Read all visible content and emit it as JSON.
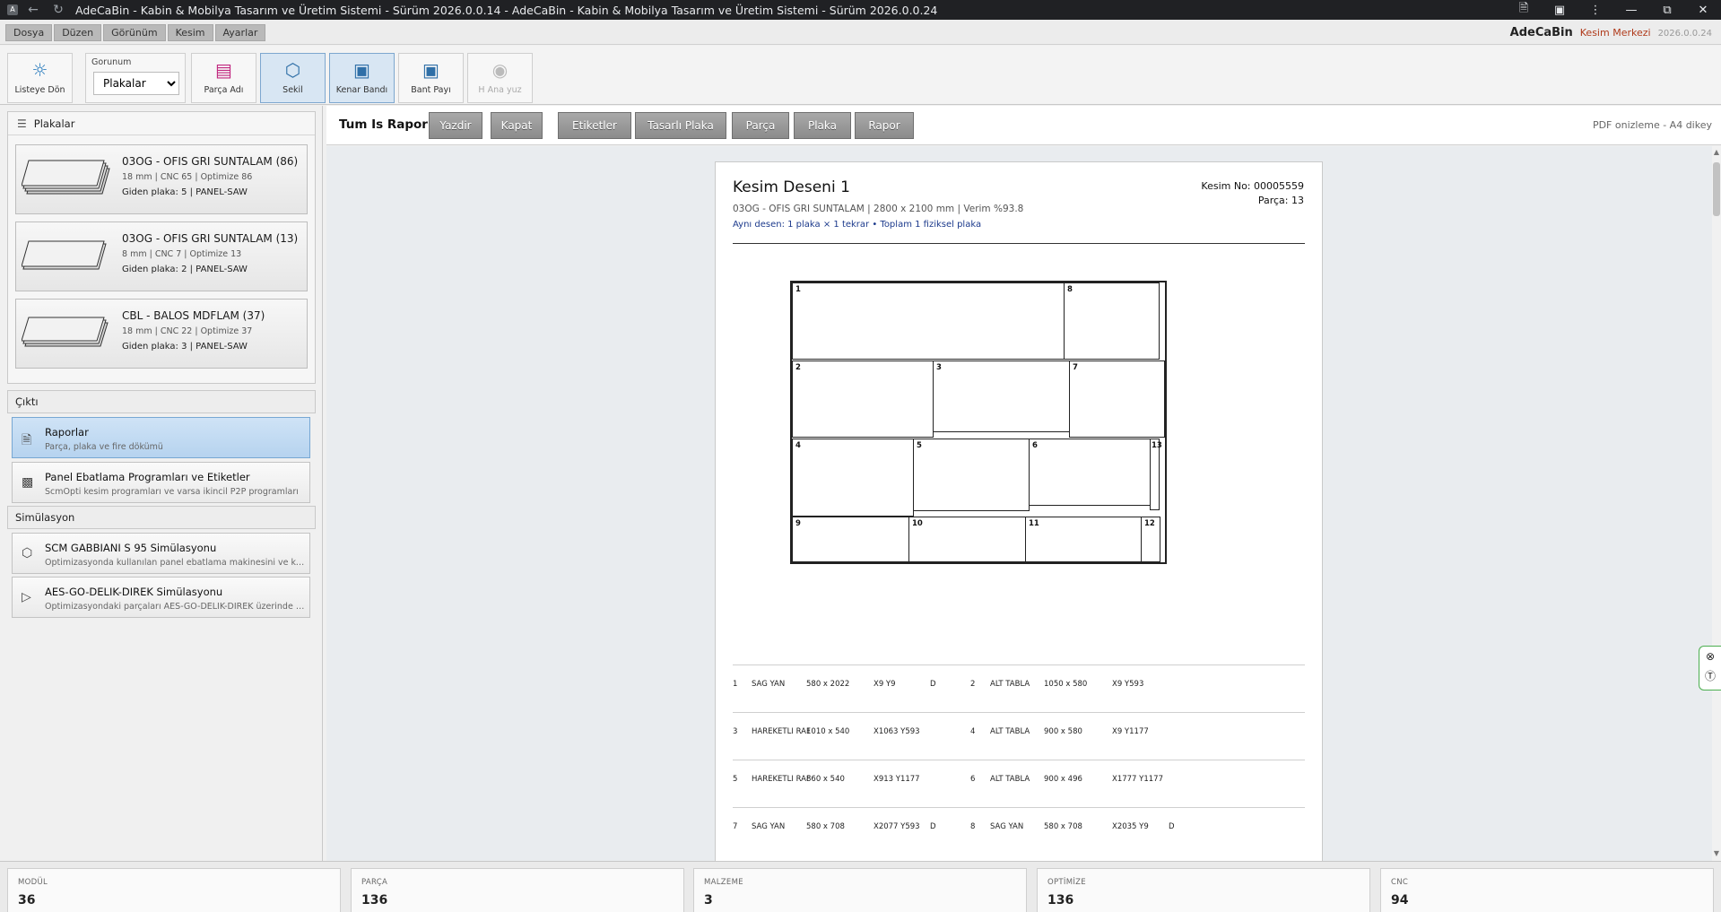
{
  "window": {
    "title": "AdeCaBin - Kabin & Mobilya Tasarım ve Üretim Sistemi - Sürüm 2026.0.0.14 - AdeCaBin - Kabin & Mobilya Tasarım ve Üretim Sistemi - Sürüm 2026.0.0.24",
    "app_icon": "A"
  },
  "menubar": {
    "items": [
      "Dosya",
      "Düzen",
      "Görünüm",
      "Kesim",
      "Ayarlar"
    ],
    "brand_name": "AdeCaBin",
    "brand_sub": "Kesim Merkezi",
    "version": "2026.0.0.24"
  },
  "toolbar": {
    "back_label": "Listeye Dön",
    "view_label": "Gorunum",
    "view_selected": "Plakalar",
    "part_name_label": "Parça Adı",
    "shape_label": "Sekil",
    "edge_band_label": "Kenar Bandı",
    "band_allowance_label": "Bant Payı",
    "main_face_label": "H Ana yuz"
  },
  "left": {
    "sheets_title": "Plakalar",
    "sheets": [
      {
        "name": "03OG - OFIS GRI SUNTALAM (86)",
        "meta": "18 mm | CNC 65 | Optimize 86",
        "out": "Giden plaka: 5 | PANEL-SAW"
      },
      {
        "name": "03OG - OFIS GRI SUNTALAM (13)",
        "meta": "8 mm | CNC 7 | Optimize 13",
        "out": "Giden plaka: 2 | PANEL-SAW"
      },
      {
        "name": "CBL - BALOS MDFLAM (37)",
        "meta": "18 mm | CNC 22 | Optimize 37",
        "out": "Giden plaka: 3 | PANEL-SAW"
      }
    ],
    "output_title": "Çıktı",
    "output_items": [
      {
        "title": "Raporlar",
        "sub": "Parça, plaka ve fire dökümü"
      },
      {
        "title": "Panel Ebatlama Programları ve Etiketler",
        "sub": "ScmOpti kesim programları ve varsa ikincil P2P programları"
      }
    ],
    "sim_title": "Simülasyon",
    "sim_items": [
      {
        "title": "SCM GABBIANI S 95 Simülasyonu",
        "sub": "Optimizasyonda kullanılan panel ebatlama makinesini ve kesim..."
      },
      {
        "title": "AES-GO-DELIK-DIREK Simülasyonu",
        "sub": "Optimizasyondaki parçaları AES-GO-DELIK-DIREK üzerinde oynat"
      }
    ]
  },
  "report": {
    "title": "Tum Is Raporu",
    "buttons": [
      "Yazdir",
      "Kapat",
      "Etiketler",
      "Tasarlı Plaka",
      "Parça",
      "Plaka",
      "Rapor"
    ],
    "pdf_hint": "PDF onizleme - A4 dikey"
  },
  "page": {
    "title": "Kesim Deseni 1",
    "subtitle": "03OG - OFIS GRI SUNTALAM | 2800 x 2100 mm | Verim %93.8",
    "note": "Aynı desen: 1 plaka × 1 tekrar • Toplam 1 fiziksel plaka",
    "cut_no": "Kesim No: 00005559",
    "part_count": "Parça: 13",
    "board_numbers": [
      "1",
      "8",
      "2",
      "3",
      "7",
      "4",
      "5",
      "6",
      "13",
      "9",
      "10",
      "11",
      "12"
    ],
    "parts": [
      {
        "no": "1",
        "name": "SAG YAN",
        "size": "580 x 2022",
        "pos": "X9 Y9",
        "edge": "D"
      },
      {
        "no": "2",
        "name": "ALT TABLA",
        "size": "1050 x 580",
        "pos": "X9 Y593",
        "edge": ""
      },
      {
        "no": "3",
        "name": "HAREKETLI RAF",
        "size": "1010 x 540",
        "pos": "X1063 Y593",
        "edge": ""
      },
      {
        "no": "4",
        "name": "ALT TABLA",
        "size": "900 x 580",
        "pos": "X9 Y1177",
        "edge": ""
      },
      {
        "no": "5",
        "name": "HAREKETLI RAF",
        "size": "860 x 540",
        "pos": "X913 Y1177",
        "edge": ""
      },
      {
        "no": "6",
        "name": "ALT TABLA",
        "size": "900 x 496",
        "pos": "X1777 Y1177",
        "edge": ""
      },
      {
        "no": "7",
        "name": "SAG YAN",
        "size": "580 x 708",
        "pos": "X2077 Y593",
        "edge": "D"
      },
      {
        "no": "8",
        "name": "SAG YAN",
        "size": "580 x 708",
        "pos": "X2035 Y9",
        "edge": "D"
      }
    ]
  },
  "stats": [
    {
      "label": "MODÜL",
      "value": "36"
    },
    {
      "label": "PARÇA",
      "value": "136"
    },
    {
      "label": "MALZEME",
      "value": "3"
    },
    {
      "label": "OPTİMİZE",
      "value": "136"
    },
    {
      "label": "CNC",
      "value": "94"
    }
  ],
  "colors": {
    "accent": "#7da7cf",
    "brand_sub": "#b03a1a",
    "note": "#1c3a8c",
    "side_tool_border": "#4caf50"
  }
}
